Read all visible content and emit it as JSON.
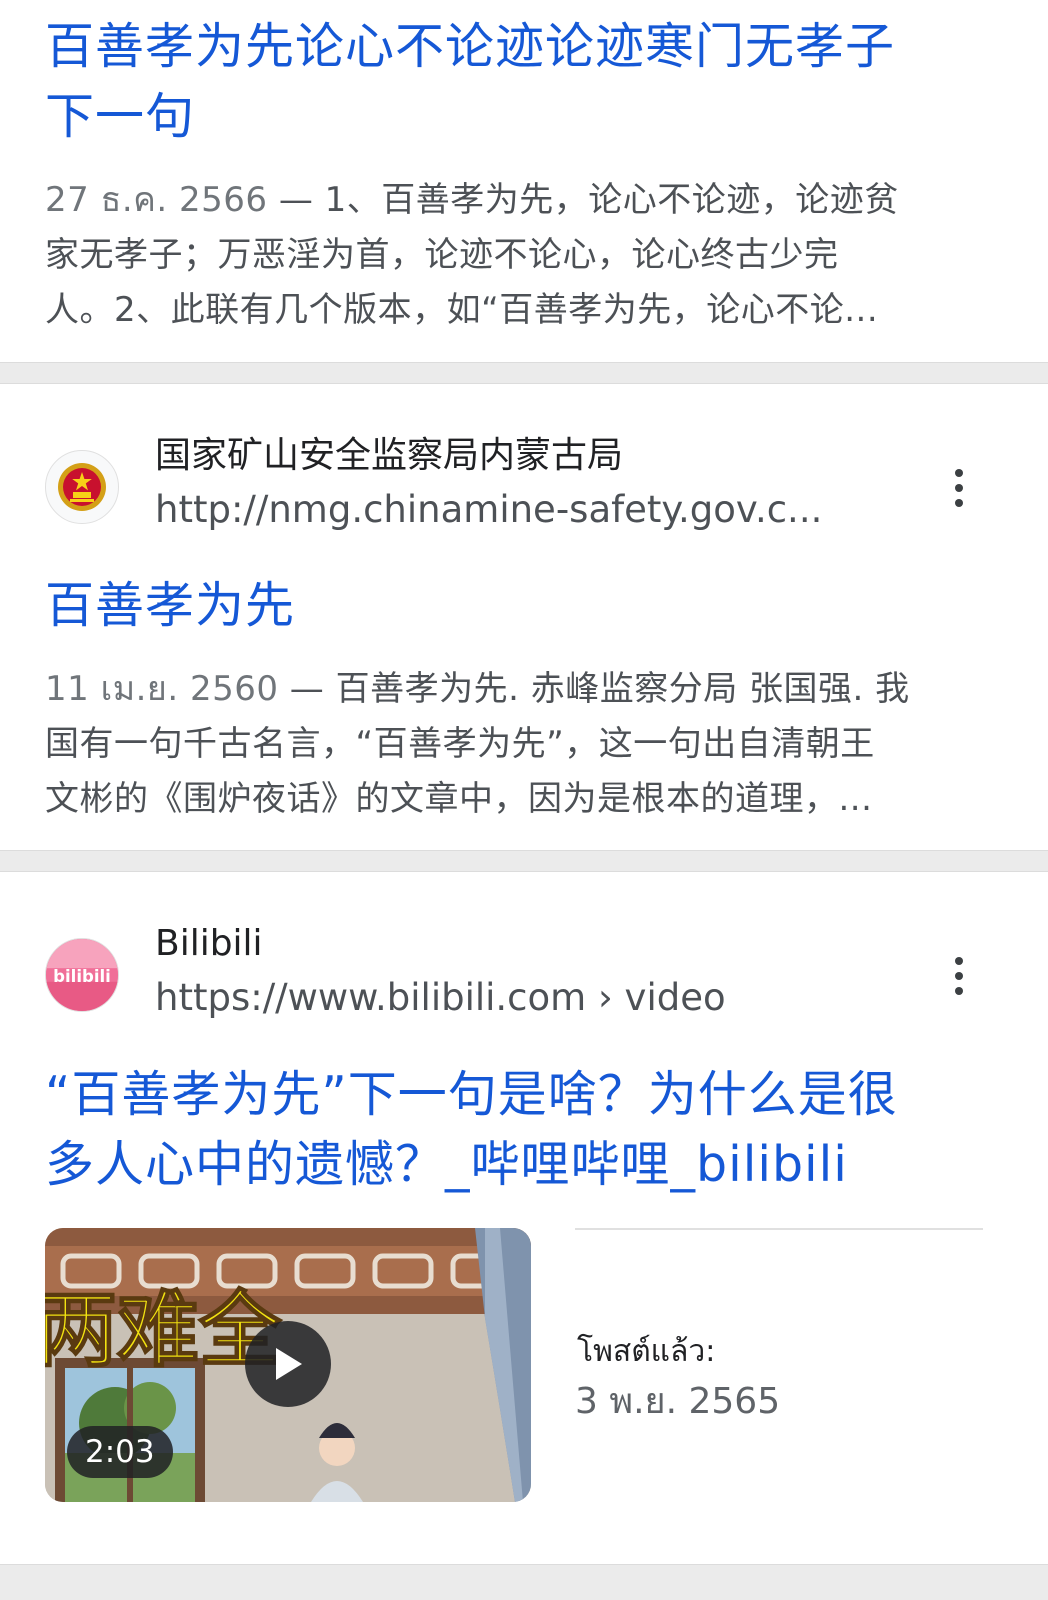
{
  "result1": {
    "title_line1": "百善孝为先论心不论迹论迹寒门无孝子",
    "title_line2": "下一句",
    "date": "27 ธ.ค. 2566",
    "dash": " — ",
    "snippet_line1": "1、百善孝为先，论心不论迹，论迹贫",
    "snippet_line2": "家无孝子；万恶淫为首，论迹不论心，论心终古少完",
    "snippet_line3": "人。2、此联有几个版本，如“百善孝为先，论心不论..."
  },
  "result2": {
    "site_name": "国家矿山安全监察局内蒙古局",
    "site_url": "http://nmg.chinamine-safety.gov.c...",
    "favicon": "national-emblem-icon",
    "title": "百善孝为先",
    "date": "11 เม.ย. 2560",
    "dash": " — ",
    "snippet_line1": "百善孝为先. 赤峰监察分局 张国强. 我",
    "snippet_line2": "国有一句千古名言，“百善孝为先”，这一句出自清朝王",
    "snippet_line3": "文彬的《围炉夜话》的文章中，因为是根本的道理，..."
  },
  "result3": {
    "site_name": "Bilibili",
    "site_url": "https://www.bilibili.com",
    "url_separator": " › ",
    "url_path": "video",
    "favicon": "bilibili-logo-icon",
    "title_line1": "“百善孝为先”下一句是啥？为什么是很",
    "title_line2": "多人心中的遗憾？_哔哩哔哩_bilibili",
    "video_duration": "2:03",
    "thumb_text": "两难全",
    "posted_label": "โพสต์แล้ว:",
    "posted_date": "3 พ.ย. 2565"
  },
  "colors": {
    "link": "#1558d6",
    "snippet": "#4d5156",
    "divider": "#ebebeb"
  },
  "icons": {
    "more": "more-vert-icon",
    "play": "play-icon"
  }
}
